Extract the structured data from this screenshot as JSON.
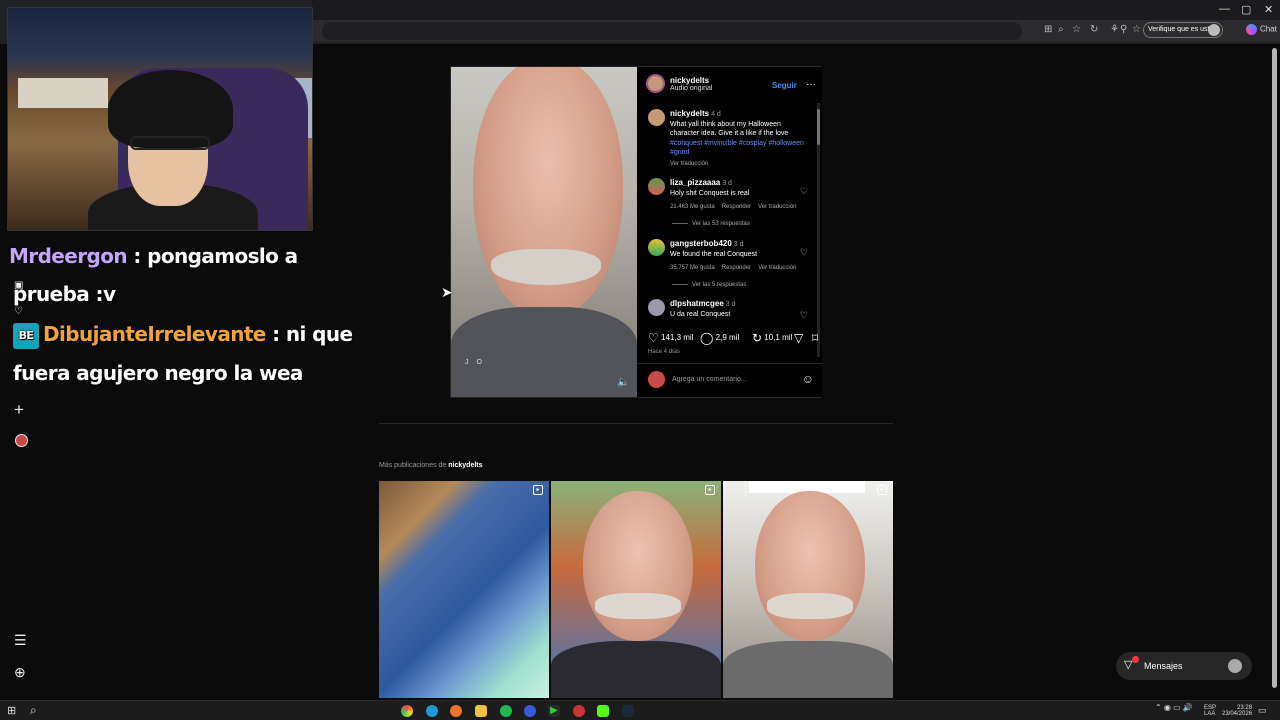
{
  "browser": {
    "verify_label": "Verifique que es usted",
    "chat_label": "Chat",
    "window_controls": [
      "—",
      "▢",
      "✕"
    ],
    "toolbar_icons": [
      "⊞",
      "⌕",
      "☆",
      "↻",
      "⚘",
      "⚲",
      "☆"
    ]
  },
  "stream_chat": {
    "msg1_user": "Mrdeergon",
    "msg1_sep": " : ",
    "msg1_text_a": "pongamoslo a",
    "msg1_text_b": "prueba :v",
    "msg2_badge": "BE",
    "msg2_user": "DibujanteIrrelevante",
    "msg2_sep": " : ",
    "msg2_text_a": "ni que",
    "msg2_text_b": "fuera agujero negro la wea"
  },
  "left_nav": {
    "plus_icon": "+",
    "menu_icon": "☰",
    "grid_icon": "⊕",
    "reels_icon": "▣",
    "explore_icon": "♡"
  },
  "post": {
    "username": "nickydelts",
    "audio": "Audio original",
    "follow": "Seguir",
    "more": "···",
    "video_mark": "J O",
    "mute_icon": "🔈",
    "caption": {
      "user": "nickydelts",
      "time": "4 d",
      "text": "What yall think about my Halloween character idea. Give it a like if the love",
      "tags": "#conquest #invincible #cosplay #holloween #grind",
      "translate": "Ver traducción"
    },
    "comments": [
      {
        "user": "liza_pizzaaaa",
        "time": "3 d",
        "text": "Holy shit Conquest is real",
        "likes": "21.463 Me gusta",
        "reply": "Responder",
        "translate": "Ver traducción",
        "replies": "Ver las 53 respuestas"
      },
      {
        "user": "gangsterbob420",
        "time": "3 d",
        "text": "We found the real Conquest",
        "likes": "35.757 Me gusta",
        "reply": "Responder",
        "translate": "Ver traducción",
        "replies": "Ver las 5 respuestas"
      },
      {
        "user": "dlpshatmcgee",
        "time": "3 d",
        "text": "U da real Conquest"
      }
    ],
    "stats": {
      "likes": "141,3 mil",
      "comments": "2,9 mil",
      "shares": "10,1 mil"
    },
    "posted": "Hace 4 días",
    "comment_placeholder": "Agrega un comentario...",
    "emoji_icon": "☺"
  },
  "more_posts": {
    "prefix": "Más publicaciones de ",
    "user": "nickydelts"
  },
  "messages": {
    "label": "Mensajes",
    "badge": "1"
  },
  "taskbar": {
    "lang1": "ESP",
    "lang2": "LAA",
    "time": "23:28",
    "date": "23/04/2026"
  },
  "colors": {
    "link_blue": "#4b8ff2",
    "hashtag": "#6b8ffb",
    "chat_user1": "#c5a6ff",
    "chat_user2": "#f2a33a"
  }
}
